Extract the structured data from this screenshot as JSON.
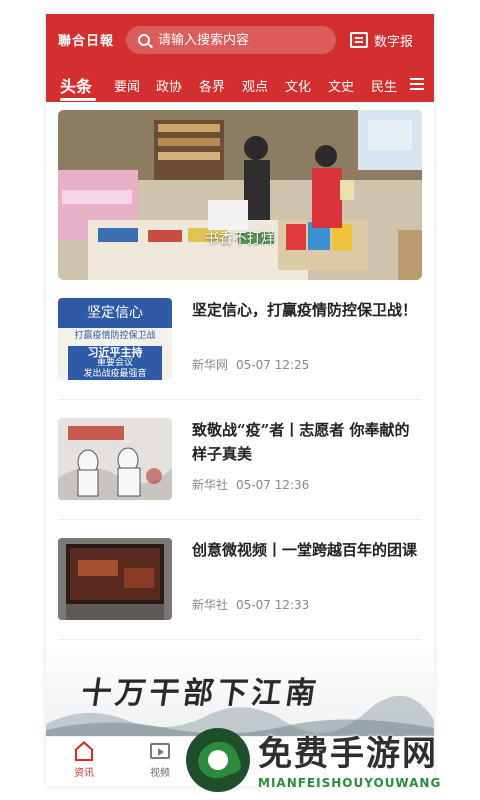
{
  "header": {
    "logo": "聯合日報",
    "search_placeholder": "请输入搜索内容",
    "epaper_label": "数字报"
  },
  "tabs": [
    {
      "label": "头条",
      "active": true
    },
    {
      "label": "要闻"
    },
    {
      "label": "政协"
    },
    {
      "label": "各界"
    },
    {
      "label": "观点"
    },
    {
      "label": "文化"
    },
    {
      "label": "文史"
    },
    {
      "label": "民生"
    }
  ],
  "hero": {
    "caption": "书香不打烊"
  },
  "news": [
    {
      "title": "坚定信心，打赢疫情防控保卫战！",
      "source": "新华网",
      "time": "05-07 12:25",
      "thumb": {
        "line1": "坚定信心",
        "line2": "打赢疫情防控保卫战",
        "line3": "习近平主持",
        "line4": "重要会议",
        "line5": "发出战疫最强音"
      }
    },
    {
      "title": "致敬战“疫”者丨志愿者 你奉献的样子真美",
      "source": "新华社",
      "time": "05-07 12:36"
    },
    {
      "title": "创意微视频丨一堂跨越百年的团课",
      "source": "新华社",
      "time": "05-07 12:33"
    }
  ],
  "banner": {
    "text": "十万干部下江南"
  },
  "bottom_nav": [
    {
      "label": "资讯",
      "active": true
    },
    {
      "label": "视频"
    }
  ],
  "watermark": {
    "title": "免费手游网",
    "subtitle": "MIANFEISHOUYOUWANG"
  },
  "colors": {
    "brand": "#d32f2f"
  }
}
